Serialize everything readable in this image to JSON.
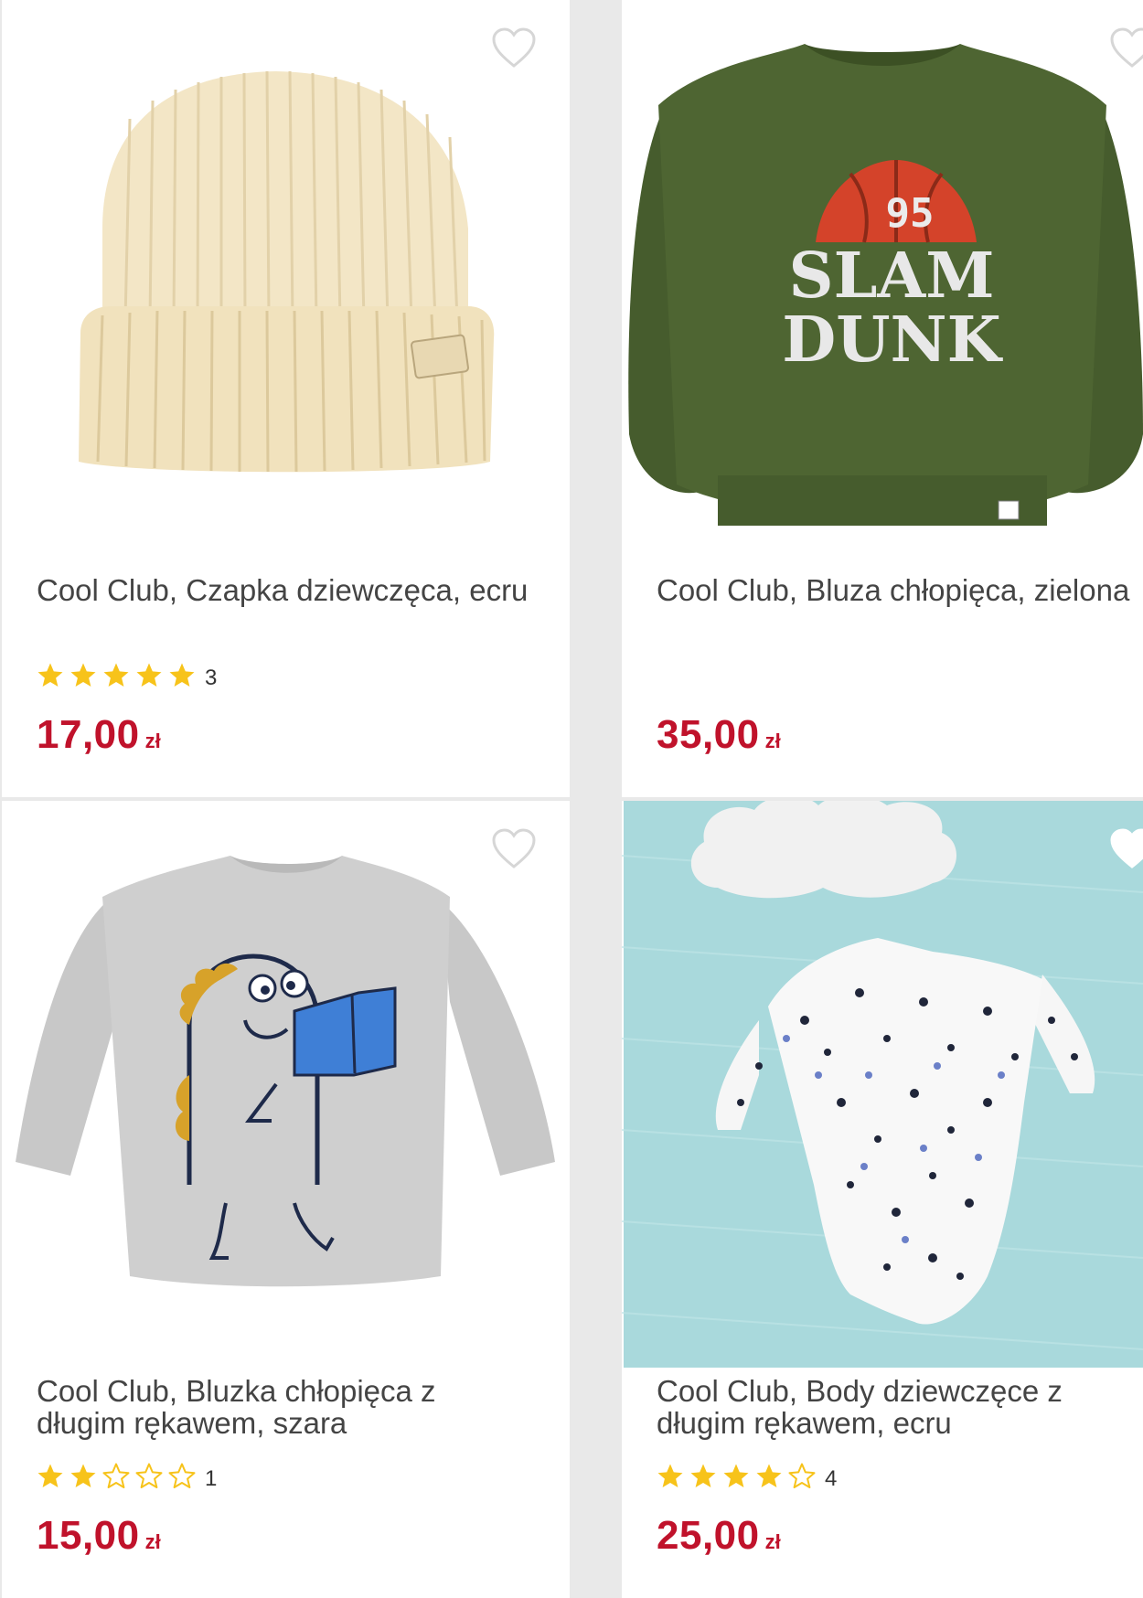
{
  "products": [
    {
      "title": "Cool Club, Czapka dziewczęca, ecru",
      "rating_stars": 5,
      "rating_count": "3",
      "price": "17,00",
      "currency": "zł",
      "image": "beanie-cream"
    },
    {
      "title": "Cool Club, Bluza chłopięca, zielona",
      "rating_stars": null,
      "rating_count": "",
      "price": "35,00",
      "currency": "zł",
      "image": "sweatshirt-green-slam-dunk",
      "print_text": [
        "95",
        "SLAM",
        "DUNK"
      ]
    },
    {
      "title": "Cool Club, Bluzka chłopięca z długim rękawem, szara",
      "rating_stars": 2,
      "rating_count": "1",
      "price": "15,00",
      "currency": "zł",
      "image": "longsleeve-grey-dino"
    },
    {
      "title": "Cool Club, Body dziewczęce z długim rękawem, ecru",
      "rating_stars": 4,
      "rating_count": "4",
      "price": "25,00",
      "currency": "zł",
      "image": "bodysuit-white-dots"
    }
  ],
  "colors": {
    "price": "#c0122b",
    "star_filled": "#f7c31a",
    "star_empty_stroke": "#f7c31a",
    "heart_stroke": "#d6d6d6"
  },
  "icons": {
    "favorite": "heart-outline-icon",
    "star": "star-icon"
  }
}
